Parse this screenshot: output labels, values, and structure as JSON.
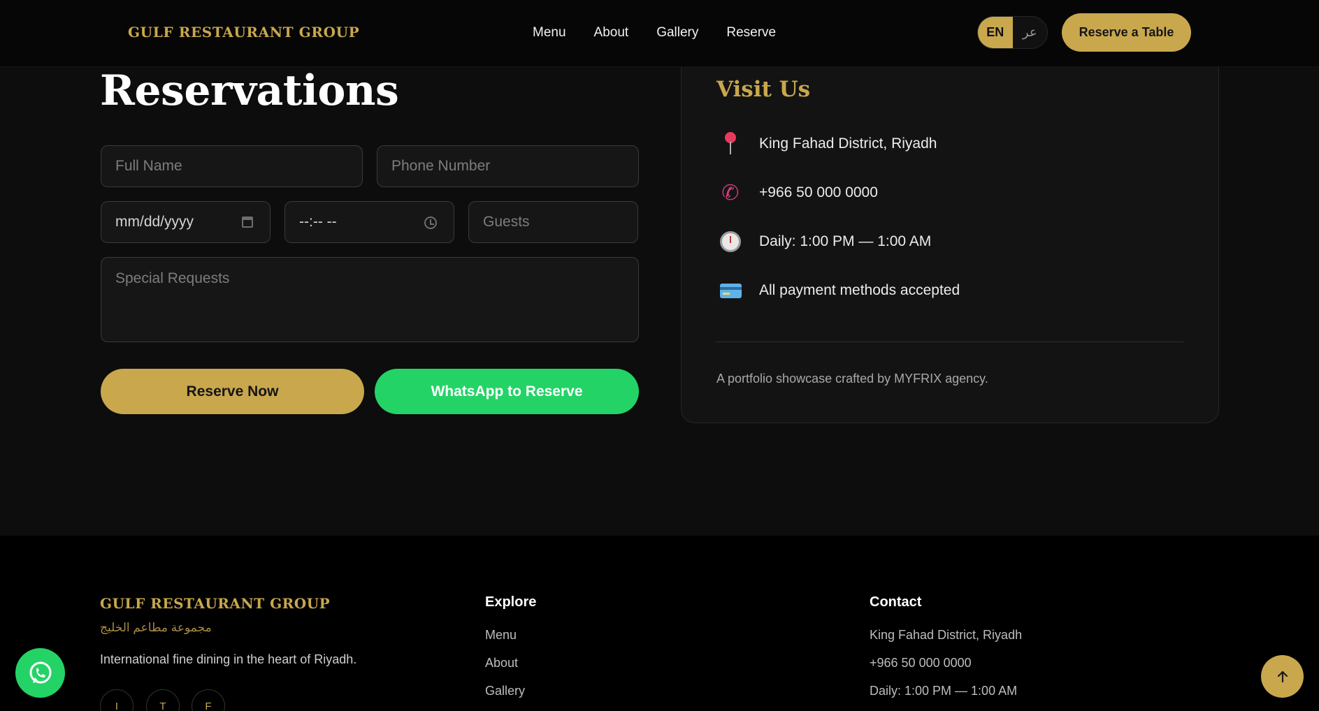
{
  "header": {
    "brand": "GULF RESTAURANT GROUP",
    "nav": [
      "Menu",
      "About",
      "Gallery",
      "Reserve"
    ],
    "lang_en": "EN",
    "lang_ar": "عر",
    "cta": "Reserve a Table"
  },
  "reservation": {
    "title": "Reservations",
    "full_name_placeholder": "Full Name",
    "phone_placeholder": "Phone Number",
    "date_value": "mm/dd/yyyy",
    "time_value": "--:-- --",
    "guests_placeholder": "Guests",
    "requests_placeholder": "Special Requests",
    "reserve_button": "Reserve Now",
    "whatsapp_button": "WhatsApp to Reserve"
  },
  "visit": {
    "title": "Visit Us",
    "address": "King Fahad District, Riyadh",
    "phone": "+966 50 000 0000",
    "hours": "Daily: 1:00 PM — 1:00 AM",
    "payment": "All payment methods accepted",
    "credit": "A portfolio showcase crafted by MYFRIX agency.",
    "icons": [
      "pin-icon",
      "phone-icon",
      "clock-icon",
      "credit-card-icon"
    ]
  },
  "footer": {
    "brand": "GULF RESTAURANT GROUP",
    "brand_arabic": "مجموعة مطاعم الخليج",
    "tagline": "International fine dining in the heart of Riyadh.",
    "social": [
      "I",
      "T",
      "F"
    ],
    "explore_heading": "Explore",
    "explore_links": [
      "Menu",
      "About",
      "Gallery"
    ],
    "contact_heading": "Contact",
    "contact_lines": [
      "King Fahad District, Riyadh",
      "+966 50 000 0000",
      "Daily: 1:00 PM — 1:00 AM"
    ]
  },
  "colors": {
    "gold": "#c9a74d",
    "whatsapp_green": "#24d366",
    "background": "#0d0d0d",
    "footer_background": "#000000"
  }
}
